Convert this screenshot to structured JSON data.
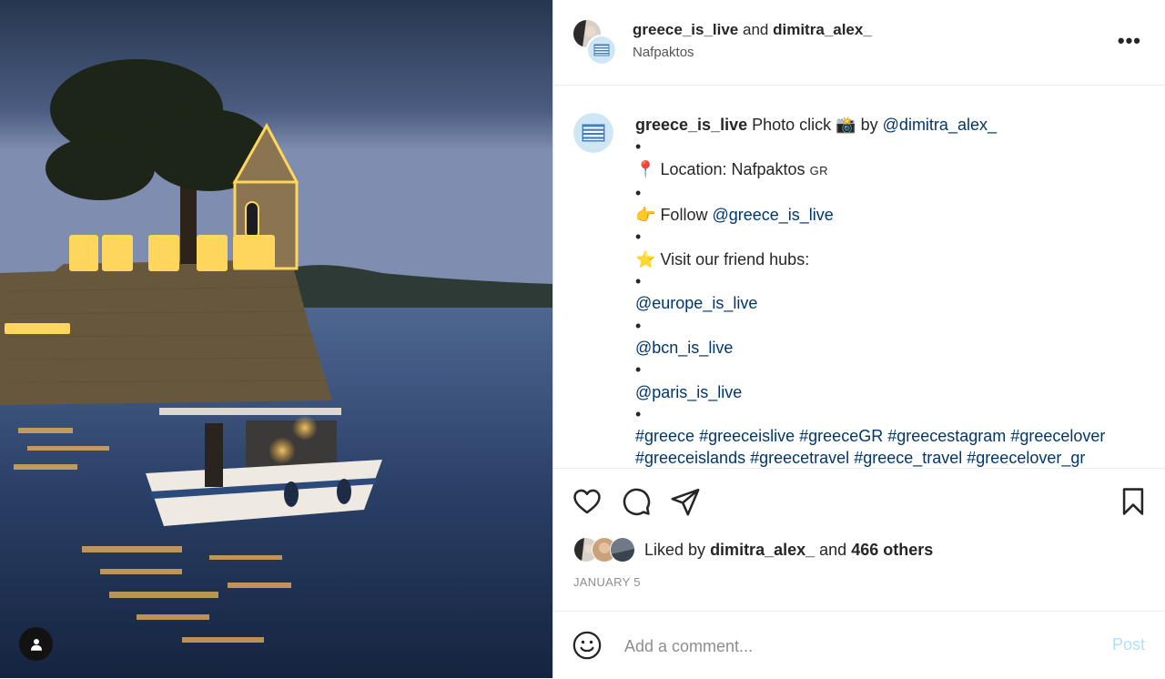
{
  "header": {
    "user1": "greece_is_live",
    "joiner": "and",
    "user2": "dimitra_alex_",
    "location": "Nafpaktos",
    "more": "•••"
  },
  "caption": {
    "username": "greece_is_live",
    "intro": "Photo click",
    "camera_emoji": "📸",
    "by": "by",
    "photographer": "@dimitra_alex_",
    "bullet": "•",
    "location_emoji": "📍",
    "location_label": "Location: Nafpaktos",
    "flag": "GR",
    "follow_emoji": "👉",
    "follow_label": "Follow",
    "follow_handle": "@greece_is_live",
    "star_emoji": "⭐",
    "friends_label": "Visit our friend hubs:",
    "hub1": "@europe_is_live",
    "hub2": "@bcn_is_live",
    "hub3": "@paris_is_live",
    "hashtags_line1": [
      "#greece",
      "#greeceislive",
      "#greeceGR",
      "#greecestagram",
      "#greecelover"
    ],
    "hashtags_line2": [
      "#greeceislands",
      "#greecetravel",
      "#greece_travel",
      "#greecelover_gr"
    ]
  },
  "likes": {
    "prefix": "Liked by",
    "user": "dimitra_alex_",
    "and": "and",
    "others": "466 others"
  },
  "date": "JANUARY 5",
  "comment": {
    "placeholder": "Add a comment...",
    "post": "Post"
  },
  "icons": {
    "like": "heart-icon",
    "comment": "comment-icon",
    "share": "share-icon",
    "save": "bookmark-icon",
    "emoji": "emoji-icon",
    "tag": "user-tag-icon"
  }
}
